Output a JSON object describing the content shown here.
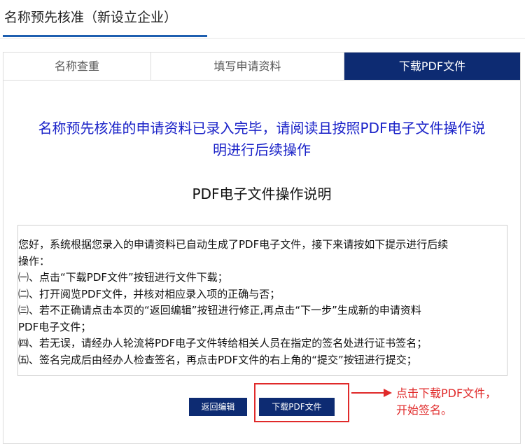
{
  "header": {
    "title": "名称预先核准（新设立企业）"
  },
  "tabs": [
    {
      "label": "名称查重",
      "active": false
    },
    {
      "label": "填写申请资料",
      "active": false
    },
    {
      "label": "下载PDF文件",
      "active": true
    }
  ],
  "notice": {
    "line1": "名称预先核准的申请资料已录入完毕，请阅读且按照PDF电子文件操作说",
    "line2": "明进行后续操作"
  },
  "section_title": "PDF电子文件操作说明",
  "instructions": {
    "intro_line1": "您好，系统根据您录入的申请资料已自动生成了PDF电子文件，接下来请按如下提示进行后续",
    "intro_line2": "操作：",
    "steps": [
      "㈠、点击“下载PDF文件”按钮进行文件下载；",
      "㈡、打开阅览PDF文件，并核对相应录入项的正确与否；",
      "㈢、若不正确请点击本页的“返回编辑”按钮进行修正,再点击“下一步”生成新的申请资料",
      "PDF电子文件；",
      "㈣、若无误，请经办人轮流将PDF电子文件转给相关人员在指定的签名处进行证书签名；",
      "㈤、签名完成后由经办人检查签名，再点击PDF文件的右上角的“提交”按钮进行提交；"
    ]
  },
  "buttons": {
    "back_label": "返回编辑",
    "download_label": "下载PDF文件"
  },
  "annotation": {
    "line1": "点击下载PDF文件，",
    "line2": "开始签名。"
  },
  "colors": {
    "primary": "#0d2b72",
    "notice_blue": "#1a22c8",
    "annotation_red": "#e02a2a",
    "underline_blue": "#1e5fb0"
  }
}
